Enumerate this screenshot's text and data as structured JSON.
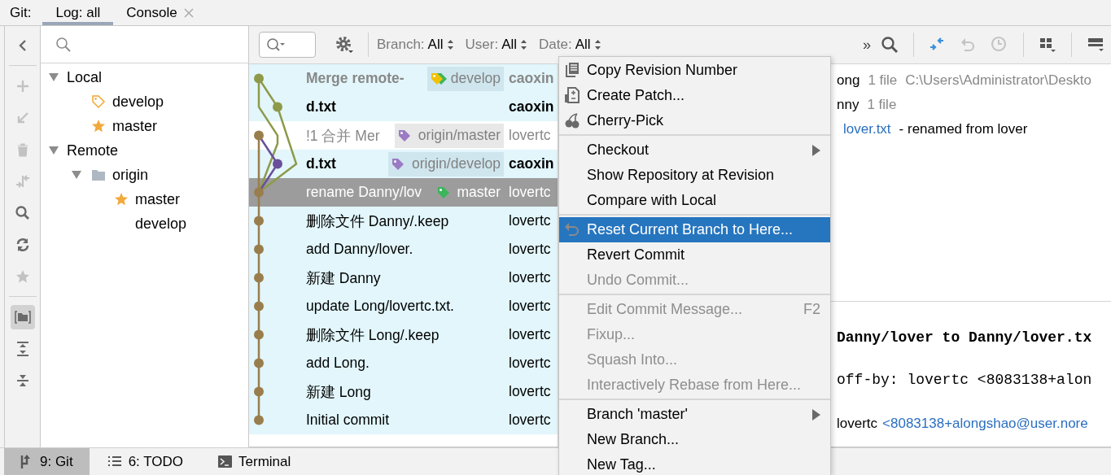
{
  "tool_window": {
    "title": "Git:",
    "tabs": [
      {
        "label": "Log: all",
        "selected": true,
        "closable": false
      },
      {
        "label": "Console",
        "selected": false,
        "closable": true
      }
    ]
  },
  "tool_buttons": [
    {
      "kind": "back",
      "disabled": false,
      "selected": false
    },
    {
      "kind": "separator"
    },
    {
      "kind": "add",
      "disabled": true,
      "selected": false
    },
    {
      "kind": "fetch",
      "disabled": true,
      "selected": false
    },
    {
      "kind": "delete",
      "disabled": true,
      "selected": false
    },
    {
      "kind": "merge",
      "disabled": true,
      "selected": false
    },
    {
      "kind": "search",
      "disabled": false,
      "selected": false
    },
    {
      "kind": "refresh",
      "disabled": false,
      "selected": false
    },
    {
      "kind": "star",
      "disabled": true,
      "selected": false
    },
    {
      "kind": "separator"
    },
    {
      "kind": "folder",
      "disabled": false,
      "selected": true
    },
    {
      "kind": "expand",
      "disabled": false,
      "selected": false
    },
    {
      "kind": "collapse",
      "disabled": false,
      "selected": false
    }
  ],
  "branch_tree": [
    {
      "label": "Local",
      "expanded": true,
      "children": [
        {
          "label": "develop",
          "kind": "tag"
        },
        {
          "label": "master",
          "kind": "star"
        }
      ]
    },
    {
      "label": "Remote",
      "expanded": true,
      "children": [
        {
          "label": "origin",
          "kind": "folder",
          "expanded": true,
          "children": [
            {
              "label": "master",
              "kind": "star"
            },
            {
              "label": "develop"
            }
          ]
        }
      ]
    }
  ],
  "log_toolbar": {
    "filters": [
      {
        "label": "Branch:",
        "value": "All"
      },
      {
        "label": "User:",
        "value": "All"
      },
      {
        "label": "Date:",
        "value": "All"
      }
    ],
    "overflow": "»",
    "actions": [
      {
        "kind": "cherry_pick",
        "disabled": false
      },
      {
        "kind": "undo",
        "disabled": true
      },
      {
        "kind": "history",
        "disabled": true
      },
      {
        "kind": "separator"
      },
      {
        "kind": "grid",
        "disabled": false
      },
      {
        "kind": "separator"
      },
      {
        "kind": "layout",
        "disabled": false
      }
    ]
  },
  "commits": [
    {
      "subject": "Merge remote-",
      "bold": true,
      "dimmed": true,
      "highlighted": true,
      "selected": false,
      "tag": {
        "label": "develop",
        "color": "#f2c200",
        "kind": "double"
      },
      "author": "caoxin"
    },
    {
      "subject": "d.txt",
      "bold": true,
      "dimmed": false,
      "highlighted": true,
      "selected": false,
      "author": "caoxin"
    },
    {
      "subject": "!1 合并 Mer",
      "bold": false,
      "dimmed": true,
      "highlighted": false,
      "selected": false,
      "tag": {
        "label": "origin/master",
        "color": "#9b7bc4",
        "kind": "single"
      },
      "author": "lovertc"
    },
    {
      "subject": "d.txt",
      "bold": true,
      "dimmed": false,
      "highlighted": true,
      "selected": false,
      "tag": {
        "label": "origin/develop",
        "color": "#9b7bc4",
        "kind": "single"
      },
      "author": "caoxin"
    },
    {
      "subject": "rename Danny/lov",
      "bold": false,
      "dimmed": false,
      "highlighted": true,
      "selected": true,
      "tag": {
        "label": "master",
        "color": "#3cb55c",
        "kind": "single"
      },
      "author": "lovertc"
    },
    {
      "subject": "删除文件 Danny/.keep",
      "bold": false,
      "dimmed": false,
      "highlighted": true,
      "selected": false,
      "author": "lovertc"
    },
    {
      "subject": "add Danny/lover.",
      "bold": false,
      "dimmed": false,
      "highlighted": true,
      "selected": false,
      "author": "lovertc"
    },
    {
      "subject": "新建 Danny",
      "bold": false,
      "dimmed": false,
      "highlighted": true,
      "selected": false,
      "author": "lovertc"
    },
    {
      "subject": "update Long/lovertc.txt.",
      "bold": false,
      "dimmed": false,
      "highlighted": true,
      "selected": false,
      "author": "lovertc"
    },
    {
      "subject": "删除文件 Long/.keep",
      "bold": false,
      "dimmed": false,
      "highlighted": true,
      "selected": false,
      "author": "lovertc"
    },
    {
      "subject": "add Long.",
      "bold": false,
      "dimmed": false,
      "highlighted": true,
      "selected": false,
      "author": "lovertc"
    },
    {
      "subject": "新建 Long",
      "bold": false,
      "dimmed": false,
      "highlighted": true,
      "selected": false,
      "author": "lovertc"
    },
    {
      "subject": "Initial commit",
      "bold": false,
      "dimmed": false,
      "highlighted": true,
      "selected": false,
      "author": "lovertc"
    }
  ],
  "details": {
    "changes": [
      {
        "name": "ong",
        "count": "1 file",
        "path": "C:\\Users\\Administrator\\Deskto"
      },
      {
        "name": "nny",
        "count": "1 file"
      }
    ],
    "file": {
      "name": "lover.txt",
      "note": "- renamed from lover"
    },
    "message": [
      "Danny/lover to Danny/lover.tx",
      "off-by: lovertc <8083138+alon"
    ],
    "author": {
      "name": "lovertc",
      "email": "<8083138+alongshao@user.nore"
    }
  },
  "context_menu": [
    [
      {
        "label": "Copy Revision Number",
        "kind": "copy",
        "disabled": false,
        "selected": false
      },
      {
        "label": "Create Patch...",
        "kind": "patch",
        "disabled": false,
        "selected": false
      },
      {
        "label": "Cherry-Pick",
        "kind": "cherry",
        "disabled": false,
        "selected": false
      }
    ],
    [
      {
        "label": "Checkout",
        "submenu": true,
        "disabled": false,
        "selected": false
      },
      {
        "label": "Show Repository at Revision",
        "disabled": false,
        "selected": false
      },
      {
        "label": "Compare with Local",
        "disabled": false,
        "selected": false
      }
    ],
    [
      {
        "label": "Reset Current Branch to Here...",
        "kind": "undo",
        "disabled": false,
        "selected": true
      },
      {
        "label": "Revert Commit",
        "disabled": false,
        "selected": false
      },
      {
        "label": "Undo Commit...",
        "disabled": true,
        "selected": false
      }
    ],
    [
      {
        "label": "Edit Commit Message...",
        "shortcut": "F2",
        "disabled": true,
        "selected": false
      },
      {
        "label": "Fixup...",
        "disabled": true,
        "selected": false
      },
      {
        "label": "Squash Into...",
        "disabled": true,
        "selected": false
      },
      {
        "label": "Interactively Rebase from Here...",
        "disabled": true,
        "selected": false
      }
    ],
    [
      {
        "label": "Branch 'master'",
        "submenu": true,
        "disabled": false,
        "selected": false
      },
      {
        "label": "New Branch...",
        "disabled": false,
        "selected": false
      },
      {
        "label": "New Tag...",
        "disabled": false,
        "selected": false
      }
    ]
  ],
  "bottom_tabs": [
    {
      "label": "9: Git",
      "kind": "git",
      "selected": true
    },
    {
      "label": "6: TODO",
      "kind": "list",
      "selected": false
    },
    {
      "label": "Terminal",
      "kind": "terminal",
      "selected": false
    }
  ]
}
